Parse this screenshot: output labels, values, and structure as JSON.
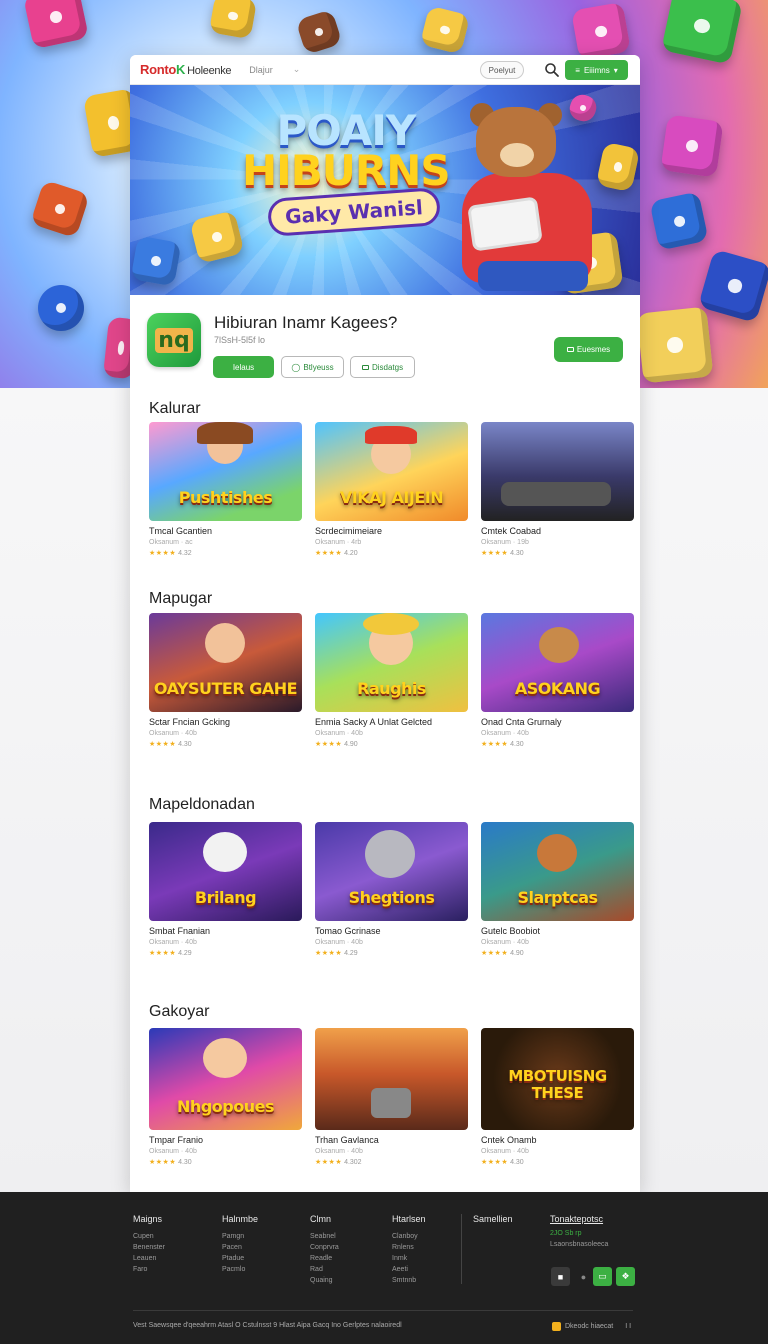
{
  "header": {
    "logo_main": "Ronto",
    "logo_k": "K",
    "logo_rest": "Holeenke",
    "nav_dropdown": "Dlajur",
    "pill_button": "Poelyut",
    "primary_button": "Eiiimns"
  },
  "banner": {
    "title_line1": "POAIY",
    "title_line2": "HIBURNS",
    "subtitle": "Gaky Wanisl"
  },
  "app": {
    "icon_text": "nq",
    "title": "Hibiuran Inamr Kagees?",
    "subtitle": "7lSsH-5l5f lo",
    "action_1": "Ielaus",
    "action_2": "Btlyeuss",
    "action_3": "Disdatgs",
    "install": "Euesmes"
  },
  "sections": [
    {
      "title": "Kalurar",
      "games": [
        {
          "thumb_text": "Pushtishes",
          "name": "Tmcal Gcantien",
          "meta": "Oksanum · ac",
          "stars": "★★★★",
          "rating": "4.32"
        },
        {
          "thumb_text": "VIKAJ AIJEIN",
          "name": "Scrdecimimeiare",
          "meta": "Oksanum · 4rb",
          "stars": "★★★★",
          "rating": "4.20"
        },
        {
          "thumb_text": "",
          "name": "Cmtek Coabad",
          "meta": "Oksanum · 19b",
          "stars": "★★★★",
          "rating": "4.30"
        }
      ]
    },
    {
      "title": "Mapugar",
      "games": [
        {
          "thumb_text": "OAYSUTER GAHE",
          "name": "Sctar Fncian Gcking",
          "meta": "Oksanum · 40b",
          "stars": "★★★★",
          "rating": "4.30"
        },
        {
          "thumb_text": "Raughis",
          "name": "Enmia Sacky A Unlat Gelcted",
          "meta": "Oksanum · 40b",
          "stars": "★★★★",
          "rating": "4.90"
        },
        {
          "thumb_text": "ASOKANG",
          "name": "Onad Cnta Grurnaly",
          "meta": "Oksanum · 40b",
          "stars": "★★★★",
          "rating": "4.30"
        }
      ]
    },
    {
      "title": "Mapeldonadan",
      "games": [
        {
          "thumb_text": "Brilang",
          "name": "Smbat Fnanian",
          "meta": "Oksanum · 40b",
          "stars": "★★★★",
          "rating": "4.29"
        },
        {
          "thumb_text": "Shegtions",
          "name": "Tomao Gcrinase",
          "meta": "Oksanum · 40b",
          "stars": "★★★★",
          "rating": "4.29"
        },
        {
          "thumb_text": "Slarptcas",
          "name": "Gutelc Boobiot",
          "meta": "Oksanum · 40b",
          "stars": "★★★★",
          "rating": "4.90"
        }
      ]
    },
    {
      "title": "Gakoyar",
      "games": [
        {
          "thumb_text": "Nhgopoues",
          "name": "Tmpar Franio",
          "meta": "Oksanum · 40b",
          "stars": "★★★★",
          "rating": "4.30"
        },
        {
          "thumb_text": "",
          "name": "Trhan Gavlanca",
          "meta": "Oksanum · 40b",
          "stars": "★★★★",
          "rating": "4.302"
        },
        {
          "thumb_text": "MBOTUISNG THESE",
          "name": "Cntek Onamb",
          "meta": "Oksanum · 40b",
          "stars": "★★★★",
          "rating": "4.30"
        }
      ]
    }
  ],
  "footer": {
    "columns": [
      {
        "head": "Maigns",
        "links": [
          "Cupen",
          "Benenster",
          "Leauen",
          "Faro"
        ]
      },
      {
        "head": "Halnmbe",
        "links": [
          "Pamgn",
          "Pacen",
          "Ptadue",
          "Pacmlo"
        ]
      },
      {
        "head": "Clmn",
        "links": [
          "Seabnel",
          "Conprvra",
          "Readle",
          "Rad",
          "Quaing"
        ]
      },
      {
        "head": "Htarlsen",
        "links": [
          "Clanboy",
          "Rnlens",
          "Inmk",
          "Aeeti",
          "Smtnnb"
        ]
      },
      {
        "head": "Samellien",
        "links": []
      }
    ],
    "contact_head": "Tonaktepotsc",
    "contact_line1": "2JO Sb rp",
    "contact_line2": "Lsaonsbnasoleeca",
    "copyright": "Vest Saewsqee d'qeeahrm Atasl O Cstulnsst 9 Hlast  Aipa  Gacq Ino  Gerlptes nalaoiredl",
    "bottom_right": "Dkeodc hiaecat",
    "bottom_right_mark": "I I"
  }
}
